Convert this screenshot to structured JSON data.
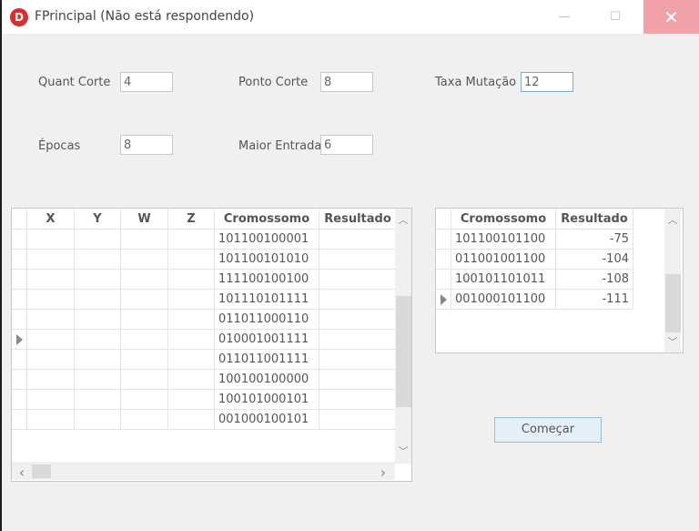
{
  "titlebar": {
    "icon_letter": "D",
    "title": "FPrincipal (Não está respondendo)",
    "close_symbol": "✕",
    "min_symbol": "—",
    "max_symbol": "☐"
  },
  "form": {
    "quant_corte_label": "Quant Corte",
    "quant_corte_value": "4",
    "ponto_corte_label": "Ponto Corte",
    "ponto_corte_value": "8",
    "taxa_mutacao_label": "Taxa Mutação",
    "taxa_mutacao_value": "12",
    "epocas_label": "Épocas",
    "epocas_value": "8",
    "maior_entrada_label": "Maior Entrada",
    "maior_entrada_value": "6"
  },
  "grid_main": {
    "columns": [
      "X",
      "Y",
      "W",
      "Z",
      "Cromossomo",
      "Resultado"
    ],
    "rows": [
      "101100100001",
      "101100101010",
      "111100100100",
      "101110101111",
      "011011000110",
      "010001001111",
      "011011001111",
      "100100100000",
      "100101000101",
      "001000100101"
    ],
    "current_row": 5
  },
  "grid_result": {
    "columns": [
      "Cromossomo",
      "Resultado"
    ],
    "rows": [
      {
        "cromossomo": "101100101100",
        "resultado": "-75"
      },
      {
        "cromossomo": "011001001100",
        "resultado": "-104"
      },
      {
        "cromossomo": "100101101011",
        "resultado": "-108"
      },
      {
        "cromossomo": "001000101100",
        "resultado": "-111"
      }
    ],
    "current_row": 3
  },
  "start_button_label": "Começar",
  "scroll_symbols": {
    "up": "︿",
    "down": "﹀",
    "left": "‹",
    "right": "›"
  }
}
